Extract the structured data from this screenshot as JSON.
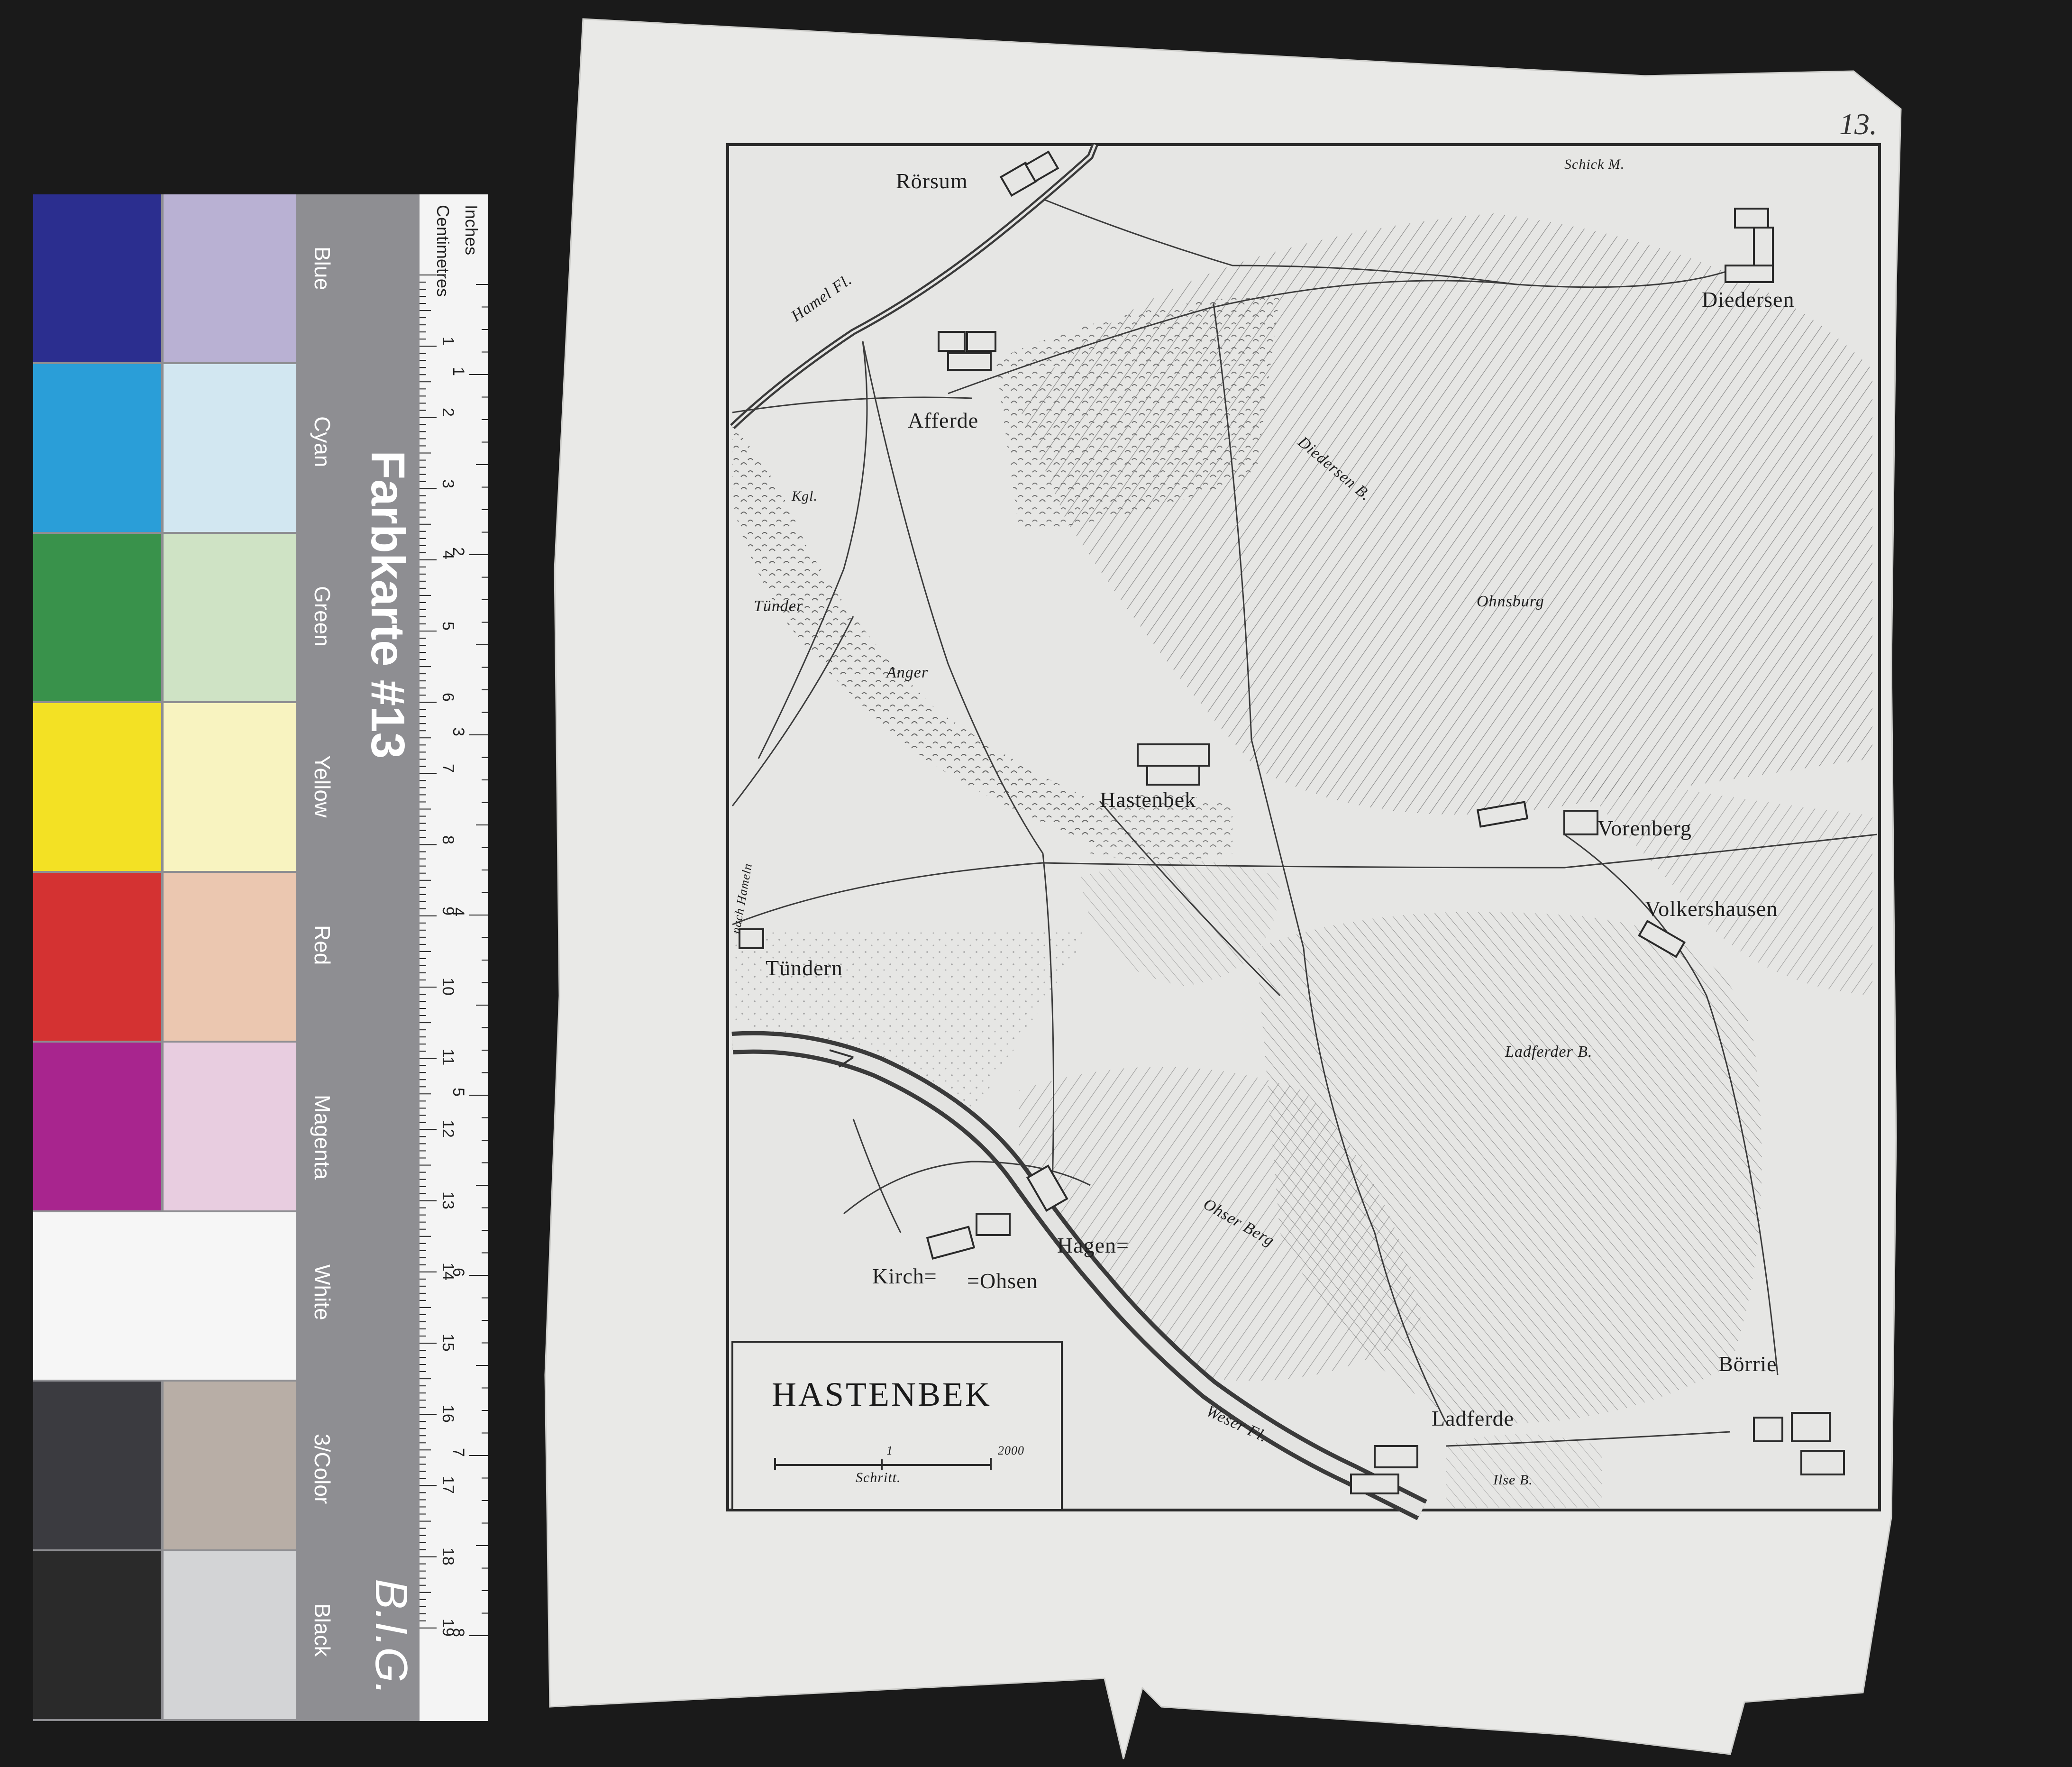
{
  "color_card": {
    "title": "Farbkarte #13",
    "brand": "B.I.G.",
    "ruler_units": [
      "Inches",
      "Centimetres"
    ],
    "inch_marks": [
      "1",
      "2",
      "3",
      "4",
      "5",
      "6",
      "7",
      "8"
    ],
    "cm_marks": [
      "1",
      "2",
      "3",
      "4",
      "5",
      "6",
      "7",
      "8",
      "9",
      "10",
      "11",
      "12",
      "13",
      "14",
      "15",
      "16",
      "17",
      "18",
      "19"
    ],
    "swatches": [
      {
        "name": "Blue",
        "full": "#2b2e8f",
        "tint": "#b9b1d3"
      },
      {
        "name": "Cyan",
        "full": "#2a9ed8",
        "tint": "#d2e7f1"
      },
      {
        "name": "Green",
        "full": "#39924b",
        "tint": "#cfe3c5"
      },
      {
        "name": "Yellow",
        "full": "#f3e124",
        "tint": "#f8f3c0"
      },
      {
        "name": "Red",
        "full": "#d43232",
        "tint": "#ebc7b0"
      },
      {
        "name": "Magenta",
        "full": "#a8258e",
        "tint": "#e8cde0"
      },
      {
        "name": "White",
        "full": "#f6f6f6",
        "tint": "#f6f6f6"
      },
      {
        "name": "3/Color",
        "full": "#3b3b40",
        "tint": "#b8aea6"
      },
      {
        "name": "Black",
        "full": "#2a2a2a",
        "tint": "#d3d4d6"
      }
    ]
  },
  "map": {
    "title": "HASTENBEK",
    "page_number": "13.",
    "scale_label": "Schritt.",
    "scale_marks": [
      "1",
      "2000"
    ],
    "places": {
      "roersum": "Rörsum",
      "schick": "Schick M.",
      "diedersen": "Diedersen",
      "hamel": "Hamel Fl.",
      "afferde": "Afferde",
      "kgl": "Kgl.",
      "tuender": "Tünder",
      "anger": "Anger",
      "diedersen_b": "Diedersen B.",
      "ohnsburg": "Ohnsburg",
      "hastenbek": "Hastenbek",
      "vorenberg": "Vorenberg",
      "nach_hameln": "nach Hameln",
      "volkershausen": "Volkershausen",
      "tuendern": "Tündern",
      "ladferder_b": "Ladferder B.",
      "ohser_berg": "Ohser Berg",
      "hagen": "Hagen=",
      "kirch": "Kirch=",
      "ohsen": "=Ohsen",
      "boerrie": "Börrie",
      "weser": "Weser Fl.",
      "ladferde": "Ladferde",
      "ilse_b": "Ilse B."
    }
  }
}
